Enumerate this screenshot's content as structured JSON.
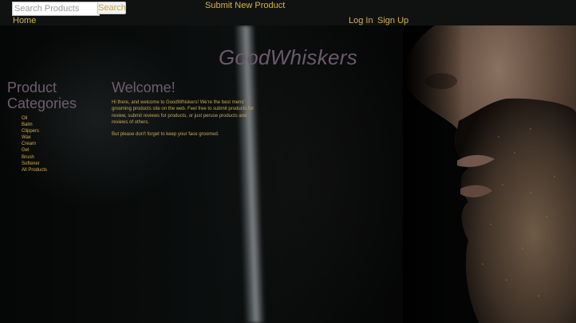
{
  "header": {
    "search_placeholder": "Search Products",
    "search_button": "Search",
    "submit_new_product": "Submit New Product",
    "home": "Home",
    "login": "Log In",
    "signup": "Sign Up"
  },
  "brand": {
    "name": "GoodWhiskers"
  },
  "sidebar": {
    "title": "Product Categories",
    "categories": [
      "Oil",
      "Balm",
      "Clippers",
      "Wax",
      "Cream",
      "Gel",
      "Brush",
      "Softener",
      "All Products"
    ]
  },
  "main": {
    "welcome_title": "Welcome!",
    "welcome_text": "Hi there, and welcome to GoodWhiskers! We're the best mens' grooming products site on the web. Feel free to submit products for review, submit reviews for products, or just peruse products and reviews of others.",
    "groom_text": "But please don't forget to keep your face groomed."
  },
  "colors": {
    "link": "#d7b24e",
    "heading": "#6d5e6d",
    "topbar": "#101211"
  }
}
